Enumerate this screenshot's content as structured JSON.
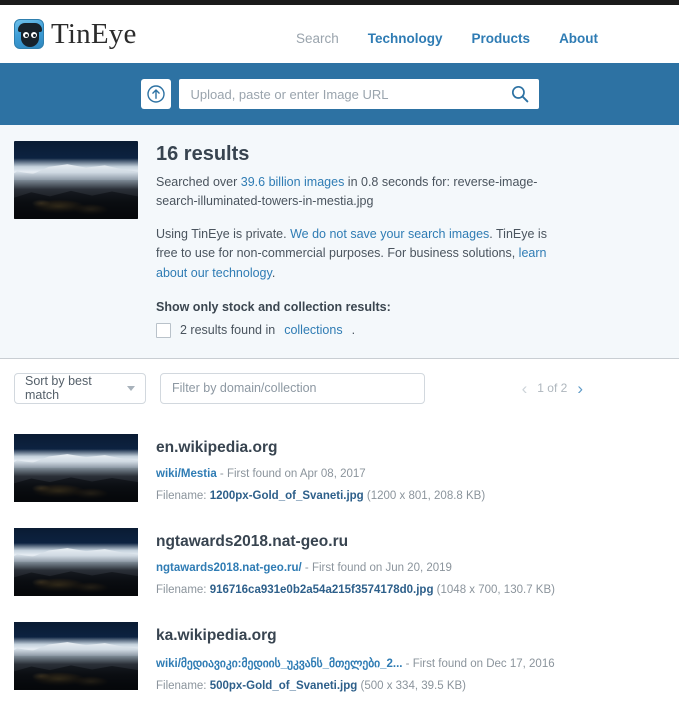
{
  "brand": {
    "name": "TinEye",
    "logo_icon": "tineye-logo-icon"
  },
  "nav": {
    "items": [
      {
        "label": "Search",
        "active": false,
        "muted": true
      },
      {
        "label": "Technology",
        "muted": false
      },
      {
        "label": "Products",
        "muted": false
      },
      {
        "label": "About",
        "muted": false
      }
    ]
  },
  "search": {
    "upload_icon": "upload-arrow-icon",
    "placeholder": "Upload, paste or enter Image URL",
    "value": "",
    "submit_icon": "magnifier-icon"
  },
  "summary": {
    "results_count": "16 results",
    "searched_prefix": "Searched over ",
    "index_size": "39.6 billion images",
    "searched_mid": " in 0.8 seconds for: ",
    "query_filename": "reverse-image-search-illuminated-towers-in-mestia.jpg",
    "privacy_prefix": "Using TinEye is private. ",
    "privacy_link": "We do not save your search images",
    "privacy_mid": ". TinEye is free to use for non-commercial purposes. For business solutions, ",
    "business_link": "learn about our technology",
    "privacy_suffix": ".",
    "stock_label": "Show only stock and collection results:",
    "stock_count_text": "2 results found in ",
    "stock_link": "collections",
    "stock_suffix": ".",
    "thumbnail_alt": "query-image-thumbnail"
  },
  "toolbar": {
    "sort_label": "Sort by best match",
    "sort_caret_icon": "chevron-down-icon",
    "filter_placeholder": "Filter by domain/collection",
    "filter_value": "",
    "pager": {
      "prev_icon": "chevron-left-icon",
      "label": "1 of 2",
      "next_icon": "chevron-right-icon"
    }
  },
  "results": [
    {
      "domain": "en.wikipedia.org",
      "path": "wiki/Mestia",
      "found": " - First found on Apr 08, 2017",
      "file_prefix": "Filename: ",
      "filename": "1200px-Gold_of_Svaneti.jpg",
      "file_meta": " (1200 x 801, 208.8 KB)",
      "thumbnail_alt": "result-image-thumbnail"
    },
    {
      "domain": "ngtawards2018.nat-geo.ru",
      "path": "ngtawards2018.nat-geo.ru/",
      "found": " - First found on Jun 20, 2019",
      "file_prefix": "Filename: ",
      "filename": "916716ca931e0b2a54a215f3574178d0.jpg",
      "file_meta": " (1048 x 700, 130.7 KB)",
      "thumbnail_alt": "result-image-thumbnail"
    },
    {
      "domain": "ka.wikipedia.org",
      "path": "wiki/მედიავიკი:მედიის_უკვანს_მთელები_2...",
      "found": " - First found on Dec 17, 2016",
      "file_prefix": "Filename: ",
      "filename": "500px-Gold_of_Svaneti.jpg",
      "file_meta": " (500 x 334, 39.5 KB)",
      "thumbnail_alt": "result-image-thumbnail"
    }
  ],
  "colors": {
    "brand_blue": "#2d72a3",
    "link_blue": "#2f7cb4",
    "summary_bg": "#f4f8fb",
    "text_dark": "#384450",
    "text_muted": "#8b949c"
  }
}
